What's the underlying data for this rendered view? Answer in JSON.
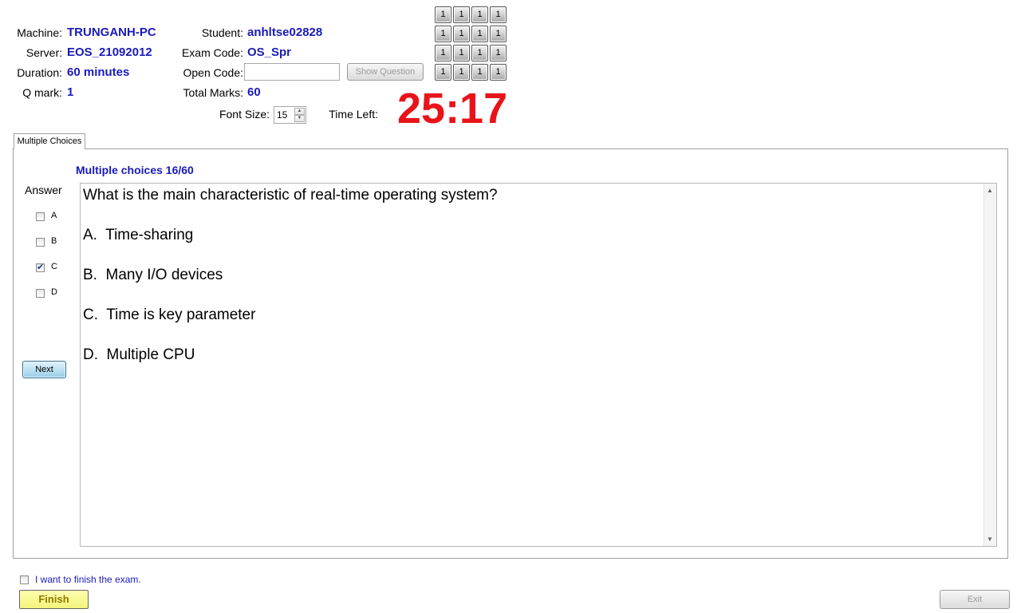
{
  "info": {
    "machine_label": "Machine:",
    "machine_value": "TRUNGANH-PC",
    "server_label": "Server:",
    "server_value": "EOS_21092012",
    "duration_label": "Duration:",
    "duration_value": "60 minutes",
    "qmark_label": "Q mark:",
    "qmark_value": "1",
    "student_label": "Student:",
    "student_value": "anhltse02828",
    "exam_code_label": "Exam Code:",
    "exam_code_value": "OS_Spr",
    "open_code_label": "Open Code:",
    "open_code_value": "",
    "show_question_label": "Show Question",
    "total_marks_label": "Total Marks:",
    "total_marks_value": "60",
    "font_size_label": "Font Size:",
    "font_size_value": "15",
    "time_left_label": "Time Left:",
    "time_left_value": "25:17"
  },
  "grid_buttons": [
    "1",
    "1",
    "1",
    "1",
    "1",
    "1",
    "1",
    "1",
    "1",
    "1",
    "1",
    "1",
    "1",
    "1",
    "1",
    "1"
  ],
  "tab": {
    "label": "Multiple Choices"
  },
  "question": {
    "header": "Multiple choices 16/60",
    "answer_label": "Answer",
    "options": [
      {
        "letter": "A",
        "checked": false
      },
      {
        "letter": "B",
        "checked": false
      },
      {
        "letter": "C",
        "checked": true
      },
      {
        "letter": "D",
        "checked": false
      }
    ],
    "next_label": "Next",
    "lines": [
      "What is the main characteristic of real-time operating system?",
      "A.  Time-sharing",
      "B.  Many I/O devices",
      "C.  Time is key parameter",
      "D.  Multiple CPU"
    ]
  },
  "footer": {
    "finish_checkbox_label": "I want to finish the exam.",
    "finish_label": "Finish",
    "exit_label": "Exit"
  },
  "colors": {
    "value_text": "#1a1ab8",
    "timer": "#e8141a",
    "finish_bg": "#f3f37a"
  }
}
